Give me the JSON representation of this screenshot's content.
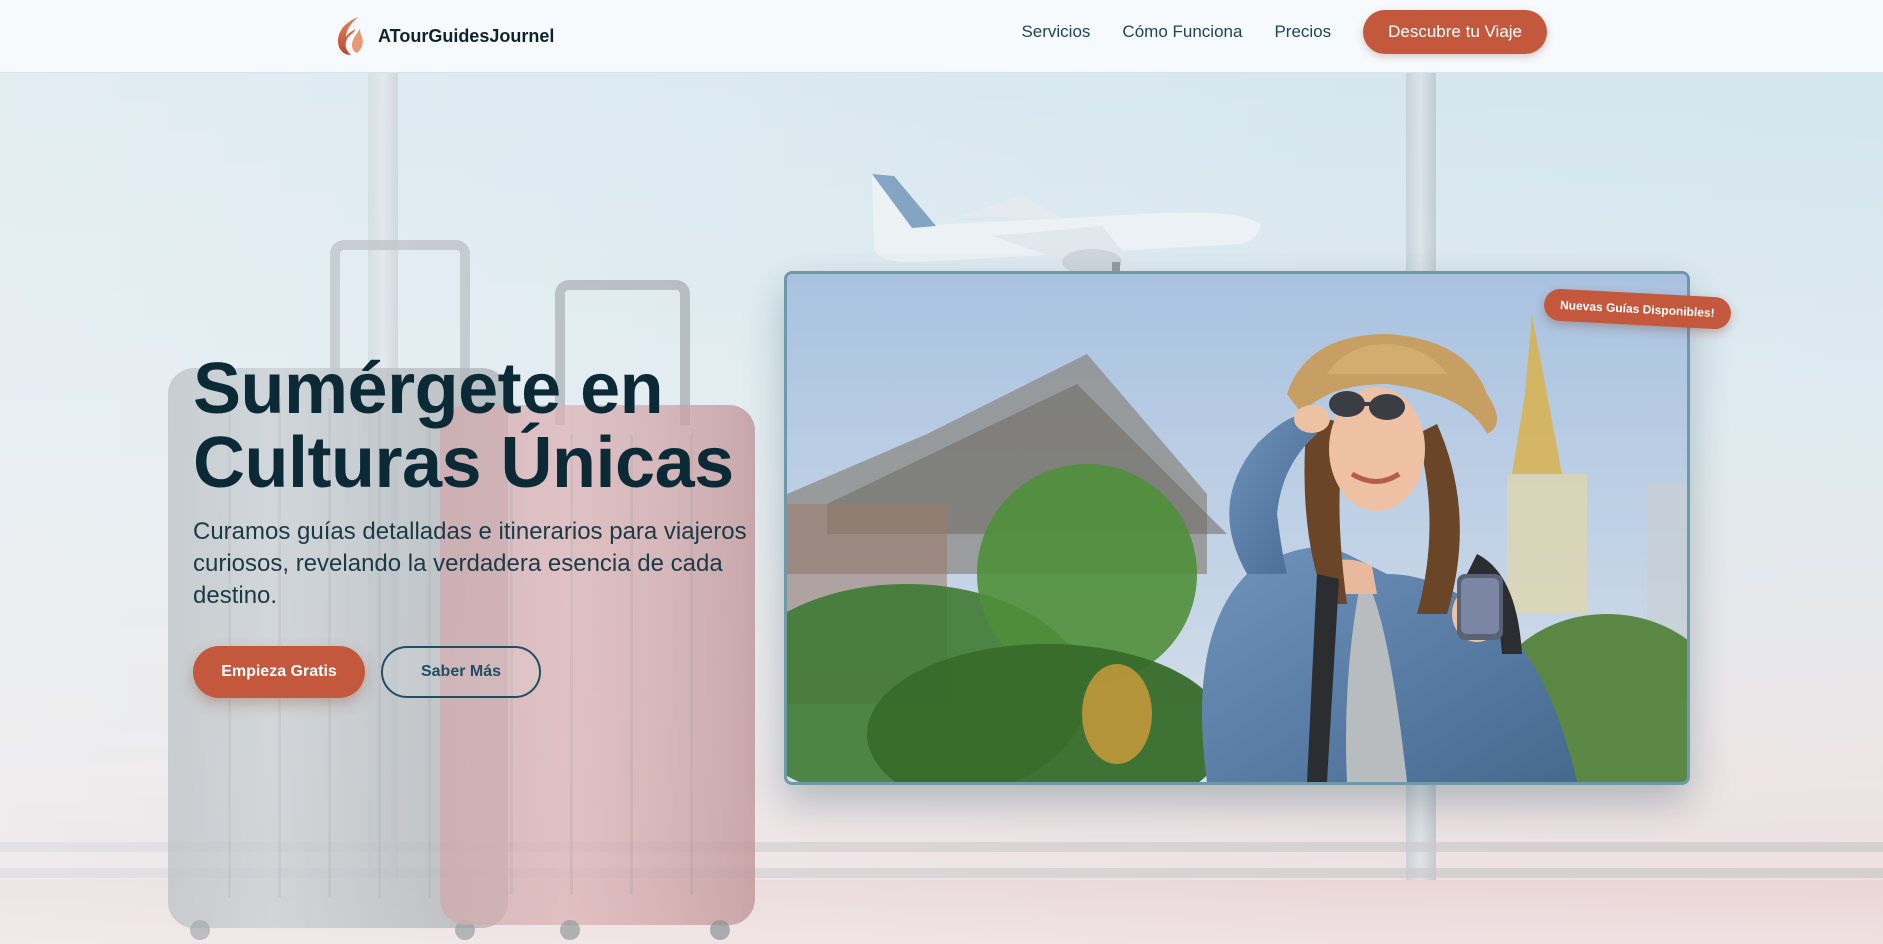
{
  "header": {
    "brand_name": "ATourGuidesJournel",
    "nav": [
      {
        "label": "Servicios"
      },
      {
        "label": "Cómo Funciona"
      },
      {
        "label": "Precios"
      }
    ],
    "cta_label": "Descubre tu Viaje"
  },
  "hero": {
    "title_line1": "Sumérgete en",
    "title_line2": "Culturas Únicas",
    "subtitle": "Curamos guías detalladas e itinerarios para viajeros curiosos, revelando la verdadera esencia de cada destino.",
    "primary_button": "Empieza Gratis",
    "secondary_button": "Saber Más",
    "badge": "Nuevas Guías Disponibles!"
  },
  "colors": {
    "accent": "#c3583d",
    "heading": "#0c2a35",
    "nav_text": "#1f4656",
    "outline": "#1f4f63"
  },
  "icons": {
    "brand": "flame-logo-icon"
  },
  "images": {
    "background": "airport window with suitcases and airplane",
    "hero_photo": "smiling woman traveler in bucket hat and sunglasses holding phone in front of temple"
  }
}
